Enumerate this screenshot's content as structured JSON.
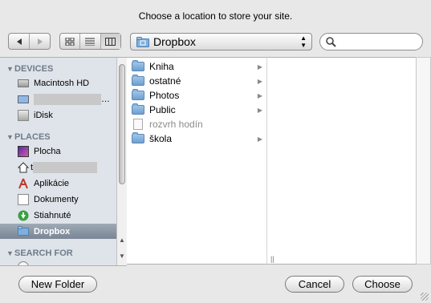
{
  "dialog": {
    "prompt": "Choose a location to store your site."
  },
  "toolbar": {
    "back_icon": "back-arrow-icon",
    "forward_icon": "forward-arrow-icon",
    "location": "Dropbox",
    "search_placeholder": ""
  },
  "sidebar": {
    "devices_header": "DEVICES",
    "devices": [
      {
        "label": "Macintosh HD",
        "icon": "hard-drive-icon"
      },
      {
        "label": "…",
        "icon": "computer-icon"
      },
      {
        "label": "iDisk",
        "icon": "idisk-icon"
      }
    ],
    "places_header": "PLACES",
    "places": [
      {
        "label": "Plocha",
        "icon": "desktop-icon"
      },
      {
        "label": "t",
        "icon": "home-icon"
      },
      {
        "label": "Aplikácie",
        "icon": "applications-icon"
      },
      {
        "label": "Dokumenty",
        "icon": "documents-icon"
      },
      {
        "label": "Stiahnuté",
        "icon": "downloads-icon"
      },
      {
        "label": "Dropbox",
        "icon": "dropbox-folder-icon",
        "selected": true
      }
    ],
    "search_header": "SEARCH FOR"
  },
  "column1": {
    "items": [
      {
        "label": "Kniha",
        "type": "folder"
      },
      {
        "label": "ostatné",
        "type": "folder"
      },
      {
        "label": "Photos",
        "type": "folder"
      },
      {
        "label": "Public",
        "type": "folder"
      },
      {
        "label": "rozvrh hodín",
        "type": "file",
        "disabled": true
      },
      {
        "label": "škola",
        "type": "folder"
      }
    ]
  },
  "buttons": {
    "new_folder": "New Folder",
    "cancel": "Cancel",
    "choose": "Choose"
  },
  "colors": {
    "sidebar_bg": "#dfe4ea",
    "selection": "#7a8595",
    "window_bg": "#e8e8e8"
  }
}
